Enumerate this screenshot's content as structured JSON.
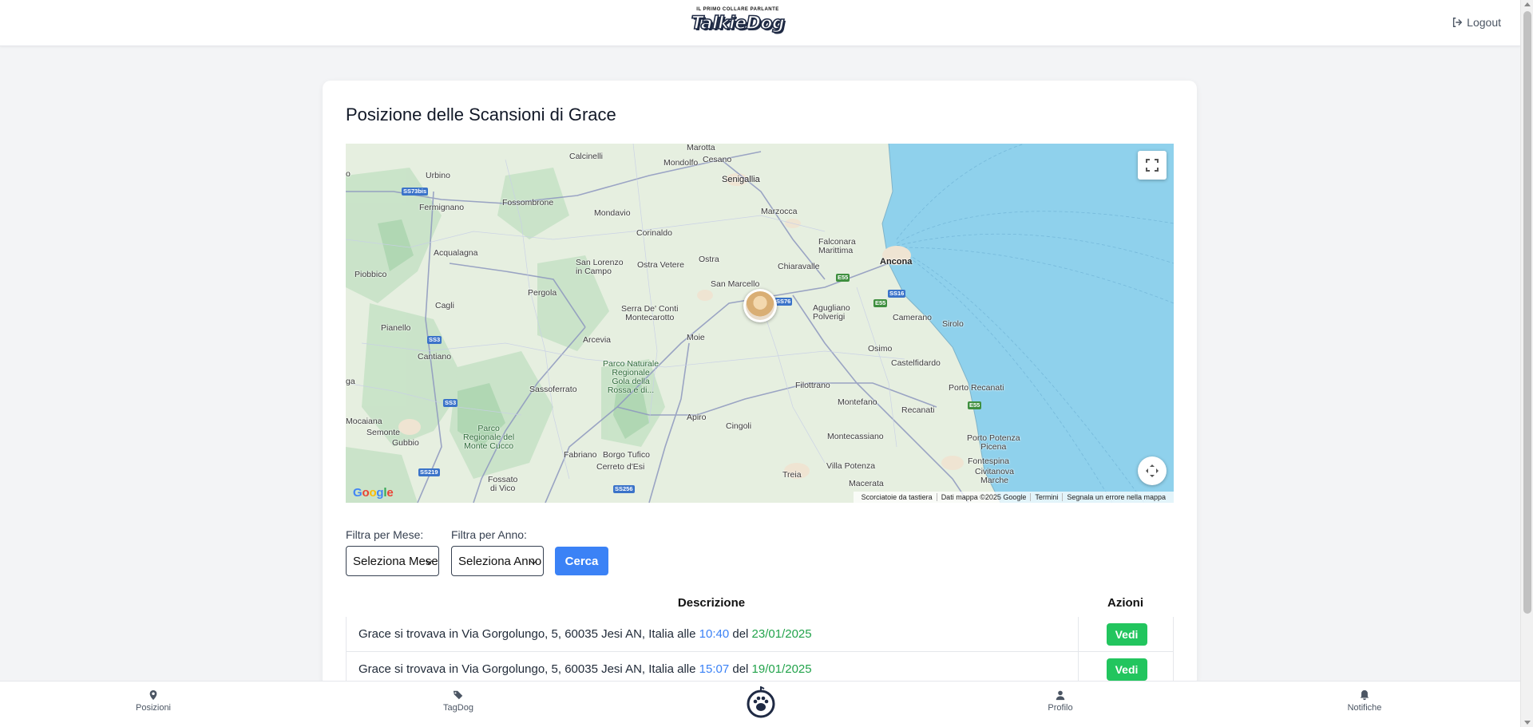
{
  "header": {
    "logo_tagline": "IL PRIMO COLLARE PARLANTE",
    "logo_text": "TalkieDog",
    "logout_label": "Logout"
  },
  "page": {
    "title": "Posizione delle Scansioni di Grace"
  },
  "map": {
    "labels": {
      "calcinelli": "Calcinelli",
      "marotta": "Marotta",
      "mondolfo": "Mondolfo",
      "cesano": "Cesano",
      "senigallia": "Senigallia",
      "urbino": "Urbino",
      "fossombrone": "Fossombrone",
      "mondavio": "Mondavio",
      "marzocca": "Marzocca",
      "fermignano": "Fermignano",
      "corinaldo": "Corinaldo",
      "falconara": "Falconara\nMarittima",
      "acqualagna": "Acqualagna",
      "ostra": "Ostra",
      "ancona": "Ancona",
      "san_lorenzo": "San Lorenzo\nin Campo",
      "ostra_vetere": "Ostra Vetere",
      "chiaravalle": "Chiaravalle",
      "piobbico": "Piobbico",
      "pergola": "Pergola",
      "san_marcello": "San Marcello",
      "cagli": "Cagli",
      "serra": "Serra De' Conti\nMontecarotto",
      "agugliano": "Agugliano\nPolverigi",
      "camerano": "Camerano",
      "sirolo": "Sirolo",
      "pianello": "Pianello",
      "moie": "Moie",
      "arcevia": "Arcevia",
      "osimo": "Osimo",
      "castelfidardo": "Castelfidardo",
      "cantiano": "Cantiano",
      "parco_gola": "Parco Naturale\nRegionale\nGola della\nRossa e di...",
      "sassoferrato": "Sassoferrato",
      "filottrano": "Filottrano",
      "porto_recanati": "Porto Recanati",
      "montefano": "Montefano",
      "recanati": "Recanati",
      "mocaiana": "Mocaiana",
      "apiro": "Apiro",
      "cingoli": "Cingoli",
      "semonte": "Semonte",
      "gubbio": "Gubbio",
      "parco_cucco": "Parco\nRegionale del\nMonte Cucco",
      "montecassiano": "Montecassiano",
      "porto_potenza": "Porto Potenza\nPicena",
      "fabriano": "Fabriano",
      "borgo_tufico": "Borgo Tufico",
      "cerreto": "Cerreto d'Esi",
      "villa_potenza": "Villa Potenza",
      "fontespina": "Fontespina",
      "civitanova": "Civitanova\nMarche",
      "fossato": "Fossato\ndi Vico",
      "treia": "Treia",
      "macerata": "Macerata",
      "edge_o": "o",
      "edge_ga": "ga"
    },
    "roads": {
      "ss73bis": "SS73bis",
      "ss3a": "SS3",
      "ss3b": "SS3",
      "ss219": "SS219",
      "ss256": "SS256",
      "ss76": "SS76",
      "e55a": "E55",
      "e55b": "E55",
      "e55c": "E55",
      "ss16": "SS16"
    },
    "google_logo": "Google",
    "attribution": {
      "shortcuts": "Scorciatoie da tastiera",
      "data": "Dati mappa ©2025 Google",
      "terms": "Termini",
      "report": "Segnala un errore nella mappa"
    },
    "colors": {
      "sea": "#8fd1ec",
      "land": "#e6efe0",
      "forest": "#b9dcbf",
      "road": "#9aa4c4"
    }
  },
  "filters": {
    "month_label": "Filtra per Mese:",
    "month_value": "Seleziona Mese",
    "year_label": "Filtra per Anno:",
    "year_value": "Seleziona Anno",
    "search_label": "Cerca"
  },
  "table": {
    "headers": {
      "description": "Descrizione",
      "actions": "Azioni"
    },
    "rows": [
      {
        "prefix": "Grace si trovava in Via Gorgolungo, 5, 60035 Jesi AN, Italia alle ",
        "time": "10:40",
        "mid": " del ",
        "date": "23/01/2025",
        "action": "Vedi"
      },
      {
        "prefix": "Grace si trovava in Via Gorgolungo, 5, 60035 Jesi AN, Italia alle ",
        "time": "15:07",
        "mid": " del ",
        "date": "19/01/2025",
        "action": "Vedi"
      }
    ]
  },
  "bottom_nav": {
    "posizioni": "Posizioni",
    "tagdog": "TagDog",
    "profilo": "Profilo",
    "notifiche": "Notifiche"
  }
}
